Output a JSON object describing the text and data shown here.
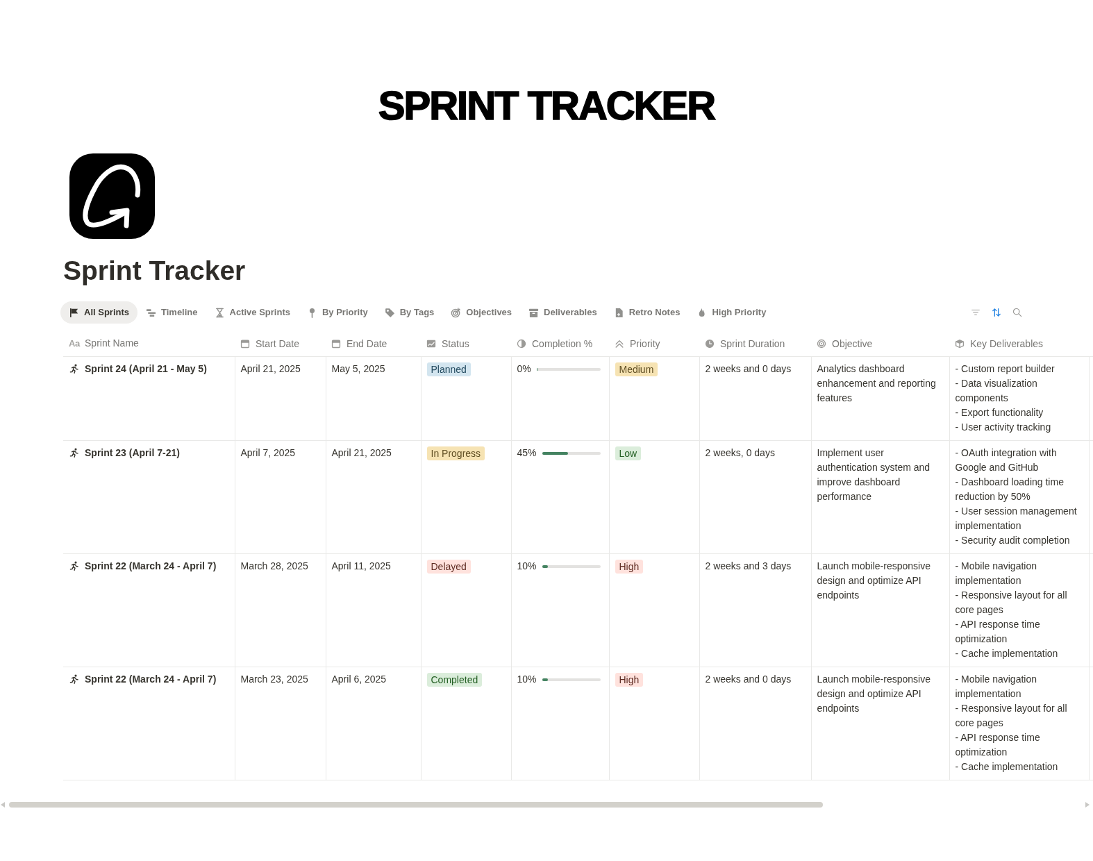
{
  "banner": {
    "title": "SPRINT TRACKER"
  },
  "page": {
    "title": "Sprint Tracker"
  },
  "views": [
    {
      "label": "All Sprints",
      "selected": true
    },
    {
      "label": "Timeline",
      "selected": false
    },
    {
      "label": "Active Sprints",
      "selected": false
    },
    {
      "label": "By Priority",
      "selected": false
    },
    {
      "label": "By Tags",
      "selected": false
    },
    {
      "label": "Objectives",
      "selected": false
    },
    {
      "label": "Deliverables",
      "selected": false
    },
    {
      "label": "Retro Notes",
      "selected": false
    },
    {
      "label": "High Priority",
      "selected": false
    }
  ],
  "toolbar": {
    "sort_active": true
  },
  "table": {
    "columns": [
      {
        "label": "Sprint Name",
        "glyph": "Aa"
      },
      {
        "label": "Start Date"
      },
      {
        "label": "End Date"
      },
      {
        "label": "Status"
      },
      {
        "label": "Completion %"
      },
      {
        "label": "Priority"
      },
      {
        "label": "Sprint Duration"
      },
      {
        "label": "Objective"
      },
      {
        "label": "Key Deliverables"
      }
    ],
    "rows": [
      {
        "name": "Sprint 24 (April 21 - May 5)",
        "start_date": "April 21, 2025",
        "end_date": "May 5, 2025",
        "status": {
          "label": "Planned",
          "color": "#d3e5ef"
        },
        "completion": {
          "reading": "0%",
          "level": 0
        },
        "priority": {
          "label": "Medium",
          "color": "#f6e3b3"
        },
        "duration": "2 weeks and 0 days",
        "objective": "Analytics dashboard enhancement and reporting features",
        "deliverables": [
          "- Custom report builder",
          "- Data visualization components",
          "- Export functionality",
          "- User activity tracking"
        ]
      },
      {
        "name": "Sprint 23 (April 7-21)",
        "start_date": "April 7, 2025",
        "end_date": "April 21, 2025",
        "status": {
          "label": "In Progress",
          "color": "#f6e3b3"
        },
        "completion": {
          "reading": "45%",
          "level": 0.45
        },
        "priority": {
          "label": "Low",
          "color": "#dbeddb"
        },
        "duration": "2 weeks, 0 days",
        "objective": "Implement user authentication system and improve dashboard performance",
        "deliverables": [
          "- OAuth integration with Google and GitHub",
          "- Dashboard loading time reduction by 50%",
          "- User session management implementation",
          "- Security audit completion"
        ]
      },
      {
        "name": "Sprint 22 (March 24 - April 7)",
        "start_date": "March 28, 2025",
        "end_date": "April 11, 2025",
        "status": {
          "label": "Delayed",
          "color": "#ffe2dd"
        },
        "completion": {
          "reading": "10%",
          "level": 0.1
        },
        "priority": {
          "label": "High",
          "color": "#ffe2dd"
        },
        "duration": "2 weeks and 3 days",
        "objective": "Launch mobile-responsive design and optimize API endpoints",
        "deliverables": [
          "- Mobile navigation implementation",
          "- Responsive layout for all core pages",
          "- API response time optimization",
          "- Cache implementation"
        ]
      },
      {
        "name": "Sprint 22 (March 24 - April 7)",
        "start_date": "March 23, 2025",
        "end_date": "April 6, 2025",
        "status": {
          "label": "Completed",
          "color": "#dbeddb"
        },
        "completion": {
          "reading": "10%",
          "level": 0.1
        },
        "priority": {
          "label": "High",
          "color": "#ffe2dd"
        },
        "duration": "2 weeks and 0 days",
        "objective": "Launch mobile-responsive design and optimize API endpoints",
        "deliverables": [
          "- Mobile navigation implementation",
          "- Responsive layout for all core pages",
          "- API response time optimization",
          "- Cache implementation"
        ]
      }
    ]
  }
}
